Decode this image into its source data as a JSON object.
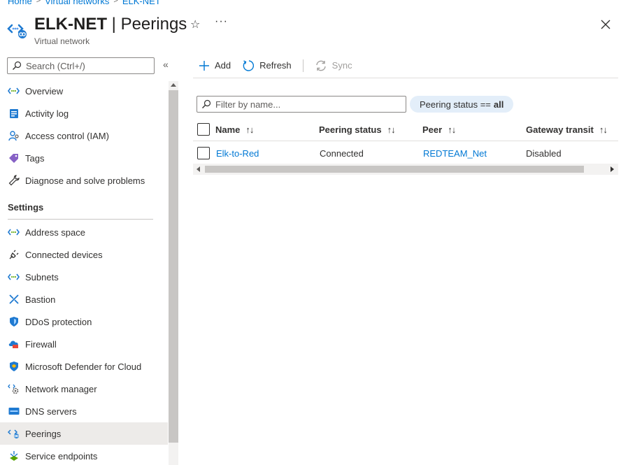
{
  "breadcrumb": [
    "Home",
    "Virtual networks",
    "ELK-NET"
  ],
  "header": {
    "resource_name": "ELK-NET",
    "separator": "|",
    "page_name": "Peerings",
    "subtitle": "Virtual network"
  },
  "sidebar": {
    "search_placeholder": "Search (Ctrl+/)",
    "top_items": [
      {
        "label": "Overview",
        "icon": "vnet-icon"
      },
      {
        "label": "Activity log",
        "icon": "activity-log-icon"
      },
      {
        "label": "Access control (IAM)",
        "icon": "iam-icon"
      },
      {
        "label": "Tags",
        "icon": "tag-icon"
      },
      {
        "label": "Diagnose and solve problems",
        "icon": "wrench-icon"
      }
    ],
    "settings_heading": "Settings",
    "settings_items": [
      {
        "label": "Address space",
        "icon": "vnet-icon"
      },
      {
        "label": "Connected devices",
        "icon": "plug-icon"
      },
      {
        "label": "Subnets",
        "icon": "vnet-icon"
      },
      {
        "label": "Bastion",
        "icon": "bastion-icon"
      },
      {
        "label": "DDoS protection",
        "icon": "shield-icon"
      },
      {
        "label": "Firewall",
        "icon": "firewall-icon"
      },
      {
        "label": "Microsoft Defender for Cloud",
        "icon": "defender-icon"
      },
      {
        "label": "Network manager",
        "icon": "network-manager-icon"
      },
      {
        "label": "DNS servers",
        "icon": "dns-icon"
      },
      {
        "label": "Peerings",
        "icon": "peering-icon",
        "active": true
      },
      {
        "label": "Service endpoints",
        "icon": "endpoint-icon"
      }
    ]
  },
  "toolbar": {
    "add": "Add",
    "refresh": "Refresh",
    "sync": "Sync"
  },
  "filter": {
    "placeholder": "Filter by name...",
    "pill_prefix": "Peering status ==",
    "pill_value": "all"
  },
  "table": {
    "columns": [
      "Name",
      "Peering status",
      "Peer",
      "Gateway transit"
    ],
    "rows": [
      {
        "name": "Elk-to-Red",
        "status": "Connected",
        "peer": "REDTEAM_Net",
        "gateway_transit": "Disabled"
      }
    ]
  },
  "colors": {
    "accent": "#0078d4",
    "active_nav": "#edebe9",
    "pill_bg": "#e3eef9"
  }
}
